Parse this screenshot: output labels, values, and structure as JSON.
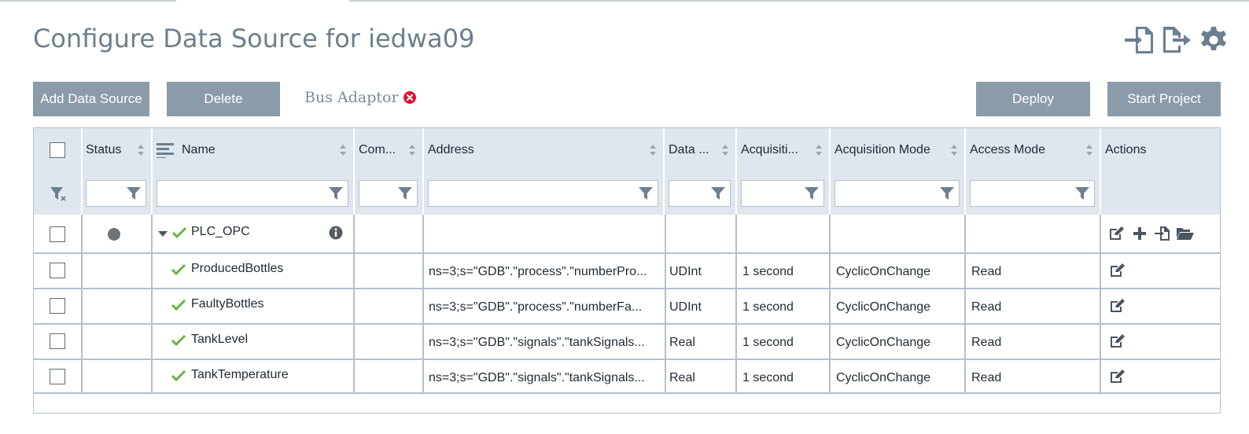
{
  "page": {
    "title": "Configure Data Source for iedwa09"
  },
  "toolbar": {
    "add_label": "Add Data Source",
    "delete_label": "Delete",
    "bus_adaptor_label": "Bus Adaptor",
    "deploy_label": "Deploy",
    "start_label": "Start Project"
  },
  "top_icons": [
    "import-icon",
    "export-icon",
    "settings-gear-icon"
  ],
  "grid": {
    "columns": [
      "Status",
      "Name",
      "Com...",
      "Address",
      "Data ...",
      "Acquisiti...",
      "Acquisition Mode",
      "Access Mode",
      "Actions"
    ],
    "parent": {
      "name": "PLC_OPC",
      "status_color": "#6e7378",
      "actions": [
        "edit-icon",
        "add-icon",
        "import-icon",
        "folder-icon"
      ]
    },
    "rows": [
      {
        "name": "ProducedBottles",
        "address": "ns=3;s=\"GDB\".\"process\".\"numberPro...",
        "data_type": "UDInt",
        "acq_cycle": "1 second",
        "acq_mode": "CyclicOnChange",
        "access": "Read"
      },
      {
        "name": "FaultyBottles",
        "address": "ns=3;s=\"GDB\".\"process\".\"numberFa...",
        "data_type": "UDInt",
        "acq_cycle": "1 second",
        "acq_mode": "CyclicOnChange",
        "access": "Read"
      },
      {
        "name": "TankLevel",
        "address": "ns=3;s=\"GDB\".\"signals\".\"tankSignals...",
        "data_type": "Real",
        "acq_cycle": "1 second",
        "acq_mode": "CyclicOnChange",
        "access": "Read"
      },
      {
        "name": "TankTemperature",
        "address": "ns=3;s=\"GDB\".\"signals\".\"tankSignals...",
        "data_type": "Real",
        "acq_cycle": "1 second",
        "acq_mode": "CyclicOnChange",
        "access": "Read"
      }
    ]
  },
  "colors": {
    "button_bg": "#8a9caa",
    "header_bg": "#dfe6ed",
    "title_color": "#6d7f8f",
    "check_green": "#6cb33f",
    "error_red": "#e0102f"
  }
}
